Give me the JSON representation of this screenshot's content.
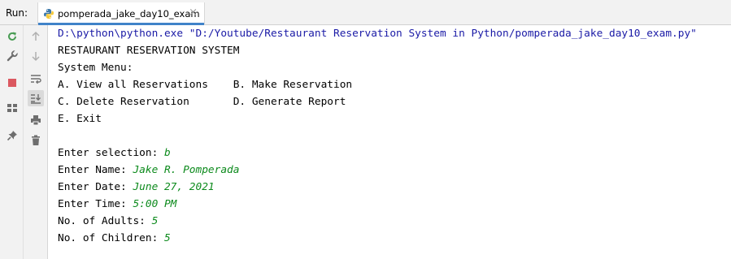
{
  "run_panel": {
    "label": "Run:",
    "tab_title": "pomperada_jake_day10_exam",
    "close_glyph": "×"
  },
  "toolbar": {
    "icons": [
      "rerun-icon",
      "up-arrow-icon",
      "settings-icon",
      "down-arrow-icon",
      "soft-wrap-icon",
      "stop-icon",
      "scroll-to-end-icon",
      "layout-icon",
      "print-icon",
      "pin-icon",
      "trash-icon"
    ]
  },
  "console": {
    "command": "D:\\python\\python.exe \"D:/Youtube/Restaurant Reservation System in Python/pomperada_jake_day10_exam.py\"",
    "title": "RESTAURANT RESERVATION SYSTEM",
    "menu_header": "System Menu:",
    "menu_row1": "A. View all Reservations    B. Make Reservation",
    "menu_row2": "C. Delete Reservation       D. Generate Report",
    "menu_row3": "E. Exit",
    "prompts": [
      {
        "label": "Enter selection: ",
        "value": "b"
      },
      {
        "label": "Enter Name: ",
        "value": "Jake R. Pomperada"
      },
      {
        "label": "Enter Date: ",
        "value": "June 27, 2021"
      },
      {
        "label": "Enter Time: ",
        "value": "5:00 PM"
      },
      {
        "label": "No. of Adults: ",
        "value": "5"
      },
      {
        "label": "No. of Children: ",
        "value": "5"
      }
    ]
  },
  "colors": {
    "command": "#1a1aa6",
    "user_input": "#0c8a1c",
    "tab_accent": "#4083c9",
    "rerun": "#499c54",
    "stop": "#db5860"
  }
}
